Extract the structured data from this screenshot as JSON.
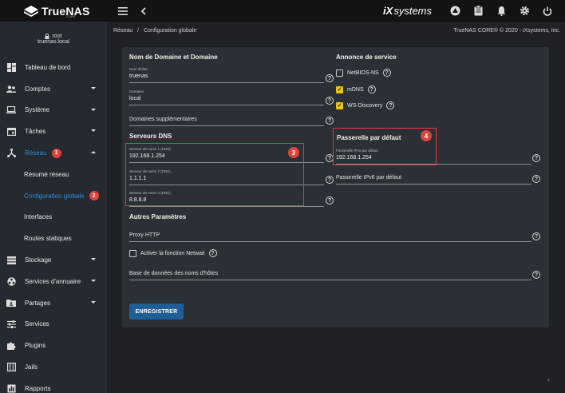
{
  "brand": {
    "name": "TrueNAS",
    "sub": "CORE"
  },
  "vendor": {
    "prefix": "iX",
    "name": "systems"
  },
  "user": {
    "name": "root",
    "host": "truenas.local"
  },
  "sidebar": {
    "items": [
      {
        "label": "Tableau de bord"
      },
      {
        "label": "Comptes"
      },
      {
        "label": "Système"
      },
      {
        "label": "Tâches"
      },
      {
        "label": "Réseau",
        "badge": "1"
      },
      {
        "label": "Stockage"
      },
      {
        "label": "Services d'annuaire"
      },
      {
        "label": "Partages"
      },
      {
        "label": "Services"
      },
      {
        "label": "Plugins"
      },
      {
        "label": "Jails"
      },
      {
        "label": "Rapports"
      }
    ],
    "sub_items": [
      {
        "label": "Résumé réseau"
      },
      {
        "label": "Configuration globale",
        "badge": "2"
      },
      {
        "label": "Interfaces"
      },
      {
        "label": "Routes statiques"
      }
    ]
  },
  "breadcrumb": {
    "root": "Réseau",
    "sep": "/",
    "current": "Configuration globale",
    "copyright": "TrueNAS CORE® © 2020 - iXsystems, Inc."
  },
  "form": {
    "domain_section": "Nom de Domaine et Domaine",
    "hostname": {
      "label": "Nom d'hôte",
      "value": "truenas"
    },
    "domain": {
      "label": "Domaine",
      "value": "local"
    },
    "extra_domains": {
      "placeholder": "Domaines supplémentaires"
    },
    "dns_section": "Serveurs DNS",
    "dns1": {
      "label": "Serveur de noms 1 (DNS)",
      "value": "192.168.1.254"
    },
    "dns2": {
      "label": "Serveur de noms 2 (DNS)",
      "value": "1.1.1.1"
    },
    "dns3": {
      "label": "Serveur de noms 3 (DNS)",
      "value": "8.8.8.8"
    },
    "service_section": "Annonce de service",
    "netbios": {
      "label": "NetBIOS-NS",
      "checked": false
    },
    "mdns": {
      "label": "mDNS",
      "checked": true
    },
    "wsd": {
      "label": "WS-Discovery",
      "checked": true
    },
    "gateway_section": "Passerelle par défaut",
    "gw4": {
      "label": "Passerelle IPv4 par défaut",
      "value": "192.168.1.254"
    },
    "gw6": {
      "placeholder": "Passerelle IPv6 par défaut"
    },
    "other_section": "Autres Paramètres",
    "proxy": {
      "placeholder": "Proxy HTTP"
    },
    "netwait": {
      "label": "Activer la fonction Netwait",
      "checked": false
    },
    "hosts_db": {
      "placeholder": "Base de données des noms d'hôtes"
    },
    "save_label": "ENREGISTRER"
  },
  "annotations": {
    "b3": "3",
    "b4": "4"
  },
  "colors": {
    "accent": "#2b8fd6",
    "annotation": "#e0433b",
    "checkbox": "#e8c400",
    "button": "#1f5e96"
  }
}
